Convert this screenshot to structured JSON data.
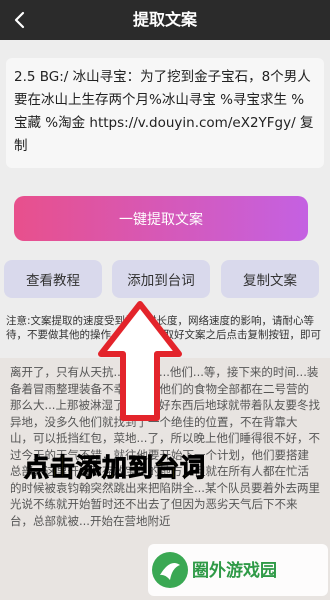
{
  "header": {
    "title": "提取文案"
  },
  "input": {
    "text": "2.5 BG:/ 冰山寻宝：为了挖到金子宝石，8个男人要在冰山上生存两个月%冰山寻宝 %寻宝求生 %宝藏 %淘金 https://v.douyin.com/eX2YFgy/ 复制"
  },
  "buttons": {
    "extract": "一键提取文案",
    "tutorial": "查看教程",
    "add": "添加到台词",
    "copy": "复制文案"
  },
  "tip": "注意:文案提取的速度受到视频时长度，网络速度的影响，请耐心等待，不要做其他的操作，当文案提取好文案之后点击复制按钮，即可",
  "result": {
    "text": "离开了，只有从天抗...冰川冰...他们...等，接下来的时间...装备着冒雨整理装备不幸的是，他们的食物全部都在二号营的那么大...上那被淋湿了，都说好东西后地球就带着队友要冬找异地，没多久他们就找到了一个绝佳的位置，不在背靠大山，可以抵挡红包，菜地...了，所以晚上他们睡得很不好，不过今天的天气不错，就往他要开始下一个计划，他们要搭建总部，这里开会和存放宝贝的地方，但就在所有人都在忙活的时候被袁钧翰突然跳出来把陷阱全...某个队员要着外去两里光说不练就开始暂时还不出去了但因为恶劣天气后下不来台，总部就被...开始在营地附近"
  },
  "overlay": {
    "caption": "点击添加到台词",
    "watermark": "圈外游戏园"
  }
}
